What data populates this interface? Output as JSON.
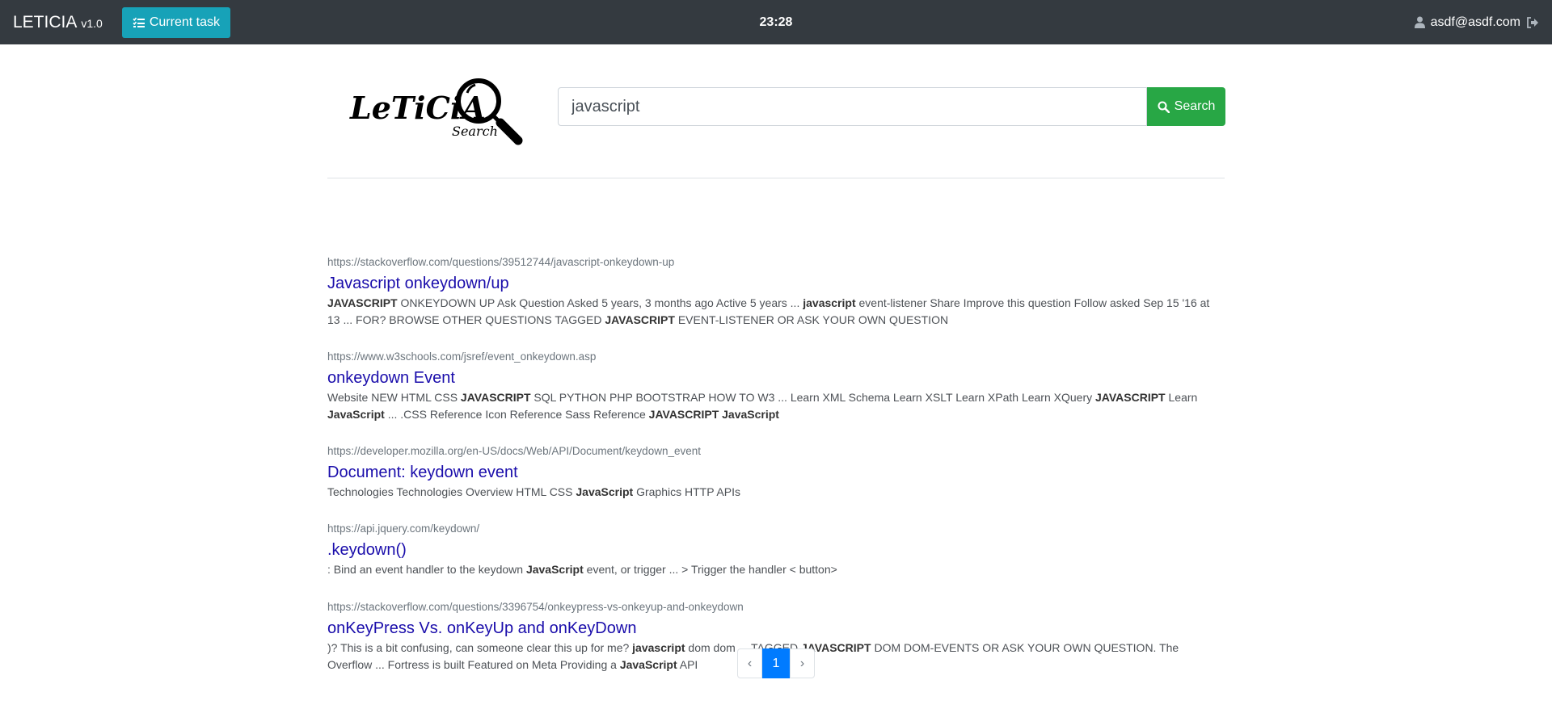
{
  "navbar": {
    "brand": "LETICIA",
    "version": "v1.0",
    "current_task_label": "Current task",
    "clock": "23:28",
    "user_email": "asdf@asdf.com"
  },
  "logo": {
    "text": "LeTiCiA",
    "subtext": "Search"
  },
  "search": {
    "query": "javascript",
    "button_label": "Search"
  },
  "results": [
    {
      "url": "https://stackoverflow.com/questions/39512744/javascript-onkeydown-up",
      "title": "Javascript onkeydown/up",
      "snippet": [
        {
          "t": "JAVASCRIPT",
          "b": true
        },
        {
          "t": " ONKEYDOWN UP Ask Question Asked 5 years, 3 months ago Active 5 years ... ",
          "b": false
        },
        {
          "t": "javascript",
          "b": true
        },
        {
          "t": " event-listener Share Improve this question Follow asked Sep 15 '16 at 13 ... FOR? BROWSE OTHER QUESTIONS TAGGED ",
          "b": false
        },
        {
          "t": "JAVASCRIPT",
          "b": true
        },
        {
          "t": " EVENT-LISTENER OR ASK YOUR OWN QUESTION",
          "b": false
        }
      ]
    },
    {
      "url": "https://www.w3schools.com/jsref/event_onkeydown.asp",
      "title": "onkeydown Event",
      "snippet": [
        {
          "t": "Website NEW HTML CSS ",
          "b": false
        },
        {
          "t": "JAVASCRIPT",
          "b": true
        },
        {
          "t": " SQL PYTHON PHP BOOTSTRAP HOW TO W3 ... Learn XML Schema Learn XSLT Learn XPath Learn XQuery ",
          "b": false
        },
        {
          "t": "JAVASCRIPT",
          "b": true
        },
        {
          "t": " Learn ",
          "b": false
        },
        {
          "t": "JavaScript",
          "b": true
        },
        {
          "t": " ... .CSS Reference Icon Reference Sass Reference ",
          "b": false
        },
        {
          "t": "JAVASCRIPT JavaScript",
          "b": true
        }
      ]
    },
    {
      "url": "https://developer.mozilla.org/en-US/docs/Web/API/Document/keydown_event",
      "title": "Document: keydown event",
      "snippet": [
        {
          "t": "Technologies Technologies Overview HTML CSS ",
          "b": false
        },
        {
          "t": "JavaScript",
          "b": true
        },
        {
          "t": " Graphics HTTP APIs",
          "b": false
        }
      ]
    },
    {
      "url": "https://api.jquery.com/keydown/",
      "title": ".keydown()",
      "snippet": [
        {
          "t": ": Bind an event handler to the keydown ",
          "b": false
        },
        {
          "t": "JavaScript",
          "b": true
        },
        {
          "t": " event, or trigger ... > Trigger the handler < button>",
          "b": false
        }
      ]
    },
    {
      "url": "https://stackoverflow.com/questions/3396754/onkeypress-vs-onkeyup-and-onkeydown",
      "title": "onKeyPress Vs. onKeyUp and onKeyDown",
      "snippet": [
        {
          "t": ")? This is a bit confusing, can someone clear this up for me? ",
          "b": false
        },
        {
          "t": "javascript",
          "b": true
        },
        {
          "t": " dom dom ... TAGGED ",
          "b": false
        },
        {
          "t": "JAVASCRIPT",
          "b": true
        },
        {
          "t": " DOM DOM-EVENTS OR ASK YOUR OWN QUESTION. The Overflow ... Fortress is built Featured on Meta Providing a ",
          "b": false
        },
        {
          "t": "JavaScript",
          "b": true
        },
        {
          "t": " API",
          "b": false
        }
      ]
    }
  ],
  "pagination": {
    "prev": "‹",
    "current": "1",
    "next": "›"
  },
  "colors": {
    "navbar": "#343a40",
    "task_button": "#17a2b8",
    "search_button": "#28a745",
    "link": "#1a0dab",
    "active_page": "#007bff"
  }
}
